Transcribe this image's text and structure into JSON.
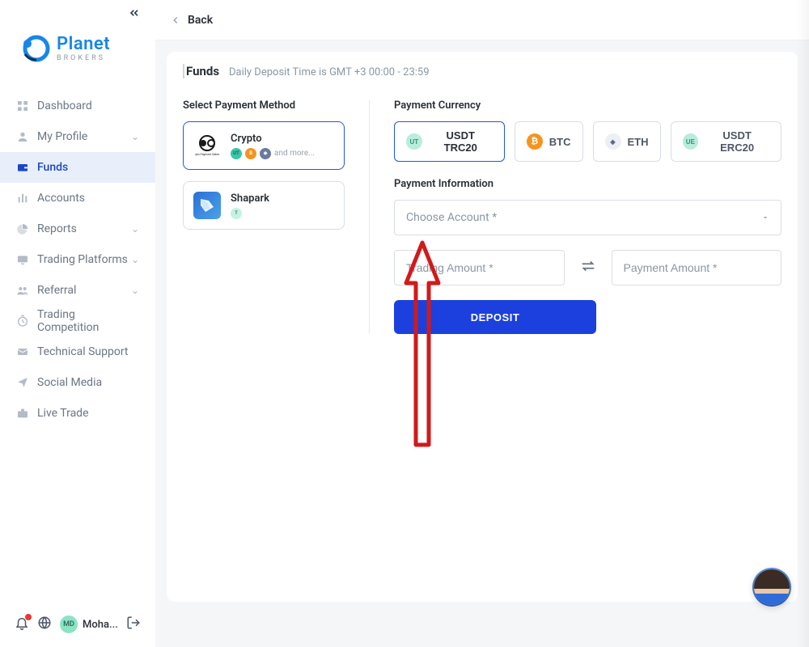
{
  "brand": {
    "name": "Planet",
    "sub": "BROKERS"
  },
  "sidebar": {
    "items": [
      {
        "label": "Dashboard",
        "icon": "grid"
      },
      {
        "label": "My Profile",
        "icon": "user",
        "expandable": true
      },
      {
        "label": "Funds",
        "icon": "wallet",
        "active": true
      },
      {
        "label": "Accounts",
        "icon": "bars"
      },
      {
        "label": "Reports",
        "icon": "pie",
        "expandable": true
      },
      {
        "label": "Trading Platforms",
        "icon": "platform",
        "expandable": true
      },
      {
        "label": "Referral",
        "icon": "people",
        "expandable": true
      },
      {
        "label": "Trading Competition",
        "icon": "clock"
      },
      {
        "label": "Technical Support",
        "icon": "mail"
      },
      {
        "label": "Social Media",
        "icon": "paperplane"
      },
      {
        "label": "Live Trade",
        "icon": "briefcase"
      }
    ]
  },
  "footer": {
    "user_initials": "MD",
    "user_name": "Moha..."
  },
  "header": {
    "back": "Back"
  },
  "card": {
    "title": "Funds",
    "subtitle": "Daily Deposit Time is GMT +3 00:00 - 23:59"
  },
  "labels": {
    "select_payment_method": "Select Payment Method",
    "payment_currency": "Payment Currency",
    "payment_information": "Payment Information"
  },
  "payment_methods": [
    {
      "name": "Crypto",
      "selected": true,
      "more": "and more..."
    },
    {
      "name": "Shapark",
      "selected": false
    }
  ],
  "currencies": [
    {
      "code": "USDT TRC20",
      "badge": "UT",
      "selected": true
    },
    {
      "code": "BTC",
      "badge": "B",
      "selected": false
    },
    {
      "code": "ETH",
      "badge": "E",
      "selected": false
    },
    {
      "code": "USDT ERC20",
      "badge": "UE",
      "selected": false
    }
  ],
  "form": {
    "account_placeholder": "Choose Account *",
    "trading_amount_placeholder": "Trading Amount *",
    "payment_amount_placeholder": "Payment Amount *",
    "deposit_button": "DEPOSIT"
  }
}
